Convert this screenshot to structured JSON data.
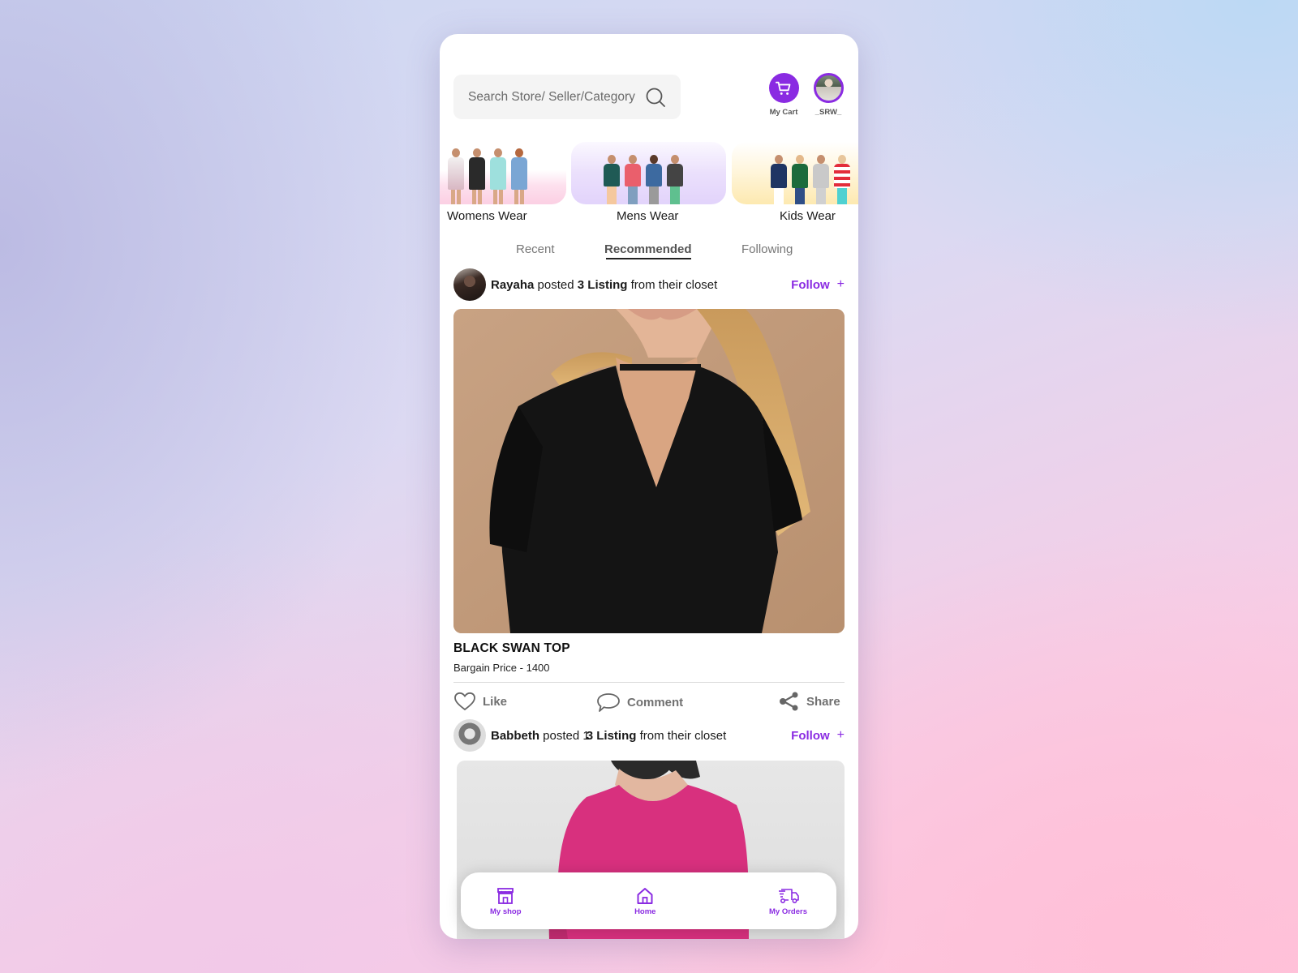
{
  "search": {
    "placeholder": "Search Store/ Seller/Category",
    "value": ""
  },
  "header": {
    "cart_label": "My Cart",
    "user_label": "_SRW_"
  },
  "categories": [
    {
      "label": "Womens Wear"
    },
    {
      "label": "Mens Wear"
    },
    {
      "label": "Kids Wear"
    }
  ],
  "tabs": [
    {
      "label": "Recent",
      "active": false
    },
    {
      "label": "Recommended",
      "active": true
    },
    {
      "label": "Following",
      "active": false
    }
  ],
  "posts": [
    {
      "user": "Rayaha",
      "verb": "posted",
      "count_listing": "3 Listing",
      "count_prefix": "",
      "suffix": "from their closet",
      "follow_label": "Follow",
      "follow_icon": "+",
      "item_title": "BLACK SWAN TOP",
      "item_price": "Bargain Price - 1400",
      "actions": {
        "like": "Like",
        "comment": "Comment",
        "share": "Share"
      }
    },
    {
      "user": "Babbeth",
      "verb": "posted",
      "count_prefix": "1",
      "count_listing": "3 Listing",
      "suffix": "from their closet",
      "follow_label": "Follow",
      "follow_icon": "+"
    }
  ],
  "nav": {
    "items": [
      {
        "label": "My shop",
        "icon": "store-icon"
      },
      {
        "label": "Home",
        "icon": "home-icon"
      },
      {
        "label": "My Orders",
        "icon": "truck-icon"
      }
    ]
  },
  "colors": {
    "accent": "#8a2be2",
    "text_primary": "#1a1a1a",
    "text_muted": "#707070"
  }
}
